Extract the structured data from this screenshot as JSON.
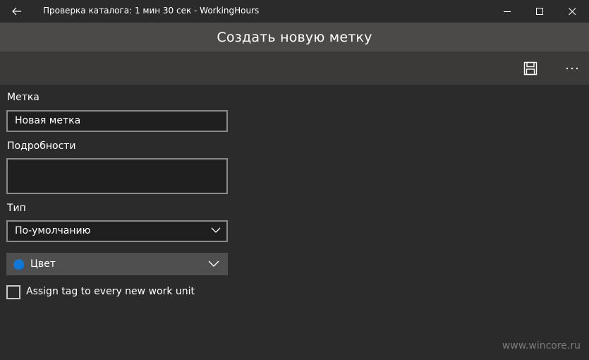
{
  "window": {
    "title": "Проверка каталога: 1 мин 30 сек - WorkingHours"
  },
  "header": {
    "title": "Создать новую метку"
  },
  "commands": {
    "save_icon": "save-icon",
    "more_icon": "more-icon",
    "more_label": "···"
  },
  "form": {
    "tag_label": "Метка",
    "tag_value": "Новая метка",
    "details_label": "Подробности",
    "details_value": "",
    "type_label": "Тип",
    "type_value": "По-умолчанию",
    "color_label": "Цвет",
    "color_value": "#0e78d4",
    "assign_label": "Assign tag to every new work unit",
    "assign_checked": false
  },
  "watermark": "www.wincore.ru"
}
